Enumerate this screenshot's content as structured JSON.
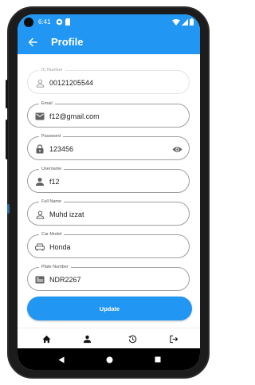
{
  "status_bar": {
    "time": "6:41"
  },
  "app_bar": {
    "title": "Profile"
  },
  "form": {
    "fields": [
      {
        "label": "IC Number",
        "value": "00121205544",
        "icon": "person-outline-icon"
      },
      {
        "label": "Email",
        "value": "f12@gmail.com",
        "icon": "email-icon"
      },
      {
        "label": "Password",
        "value": "123456",
        "icon": "lock-icon"
      },
      {
        "label": "Username",
        "value": "f12",
        "icon": "person-filled-icon"
      },
      {
        "label": "Full Name",
        "value": "Muhd izzat",
        "icon": "person-outline-icon"
      },
      {
        "label": "Car Model",
        "value": "Honda",
        "icon": "car-icon"
      },
      {
        "label": "Plate Number",
        "value": "NDR2267",
        "icon": "card-icon"
      }
    ],
    "update_label": "Update"
  },
  "colors": {
    "primary": "#2196f3",
    "field_border": "#9e9e9e",
    "icon": "#616161"
  }
}
